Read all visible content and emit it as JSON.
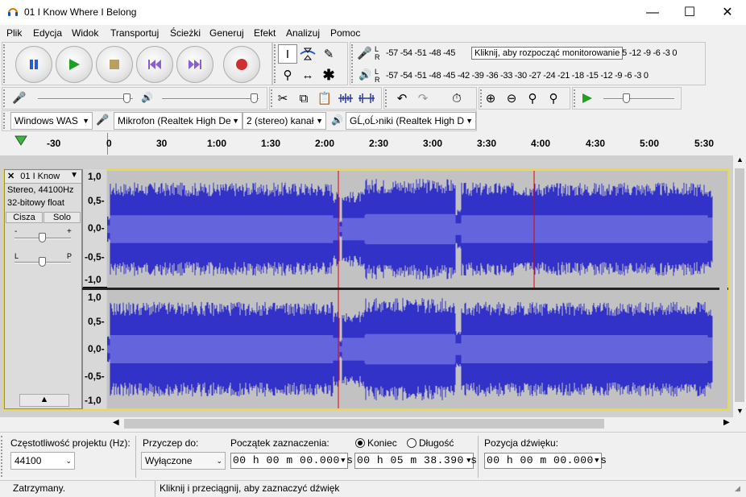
{
  "window": {
    "title": "01 I Know Where I Belong",
    "minimize": "—",
    "maximize": "☐",
    "close": "✕"
  },
  "menu": [
    "Plik",
    "Edycja",
    "Widok",
    "Transportuj",
    "Ścieżki",
    "Generuj",
    "Efekt",
    "Analizuj",
    "Pomoc"
  ],
  "meters": {
    "record_lr": [
      "L",
      "R"
    ],
    "play_lr": [
      "L",
      "R"
    ],
    "record_ticks": "-57 -54 -51 -48 -45",
    "record_ticks_right": "-15 -12  -9  -6  -3  0",
    "record_tooltip": "Kliknij, aby rozpocząć monitorowanie",
    "play_ticks": "-57 -54 -51 -48 -45 -42 -39 -36 -33 -30 -27 -24 -21 -18 -15 -12  -9  -6  -3  0"
  },
  "devices": {
    "host": "Windows WAS",
    "mic": "Mikrofon (Realtek High De",
    "channels": "2 (stereo) kanał",
    "speakers": "GĹ‚oĹ›niki (Realtek High D"
  },
  "ruler": {
    "labels": [
      "-30",
      "0",
      "30",
      "1:00",
      "1:30",
      "2:00",
      "2:30",
      "3:00",
      "3:30",
      "4:00",
      "4:30",
      "5:00",
      "5:30"
    ]
  },
  "track": {
    "name": "01 I Know",
    "format": "Stereo, 44100Hz",
    "bits": "32-bitowy float",
    "mute": "Cisza",
    "solo": "Solo",
    "gain_minus": "-",
    "gain_plus": "+",
    "pan_left": "L",
    "pan_right": "P",
    "y_labels": [
      "1,0",
      "0,5-",
      "0,0-",
      "-0,5-",
      "-1,0"
    ]
  },
  "selection_toolbar": {
    "rate_label": "Częstotliwość projektu (Hz):",
    "rate_value": "44100",
    "snap_label": "Przyczep do:",
    "snap_value": "Wyłączone",
    "start_label": "Początek zaznaczenia:",
    "end_radio": "Koniec",
    "length_radio": "Długość",
    "position_label": "Pozycja dźwięku:",
    "start_time": "00 h 00 m 00.000 s",
    "end_time": "00 h 05 m 38.390 s",
    "position_time": "00 h 00 m 00.000 s"
  },
  "status": {
    "state": "Zatrzymany.",
    "hint": "Kliknij i przeciągnij, aby zaznaczyć dźwięk"
  },
  "colors": {
    "wave": "#3232c8",
    "wave_rms": "#6464dc",
    "cursor": "#e00000",
    "wave_bg": "#c2c2c2"
  }
}
